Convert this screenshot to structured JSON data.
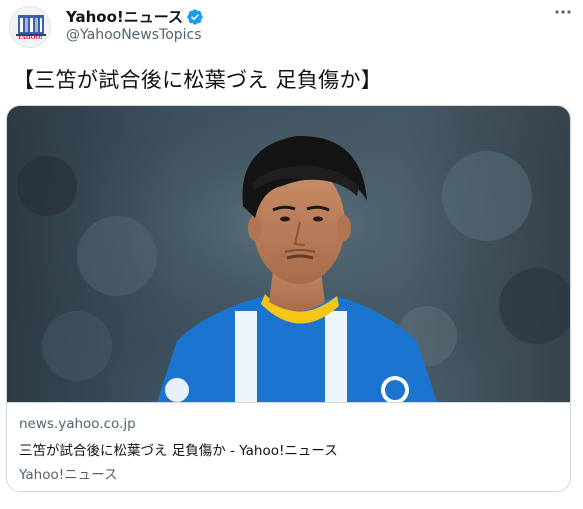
{
  "account": {
    "display_name": "Yahoo!ニュース",
    "handle": "@YahooNewsTopics",
    "avatar_text": "YAHOO!",
    "avatar_icon": "yahoo-news-logo-icon",
    "verified_icon": "verified-badge-icon",
    "verified_color": "#1d9bf0"
  },
  "menu": {
    "icon": "more-dots-icon"
  },
  "tweet": {
    "text": "【三笘が試合後に松葉づえ 足負傷か】"
  },
  "card": {
    "image_alt": "soccer-player-photo",
    "domain": "news.yahoo.co.jp",
    "title": "三笘が試合後に松葉づえ 足負傷か - Yahoo!ニュース",
    "site": "Yahoo!ニュース"
  },
  "colors": {
    "text": "#0f1419",
    "secondary": "#536471",
    "border": "#cfd9de",
    "jersey_blue": "#1b75d0",
    "collar_yellow": "#f5c518"
  }
}
